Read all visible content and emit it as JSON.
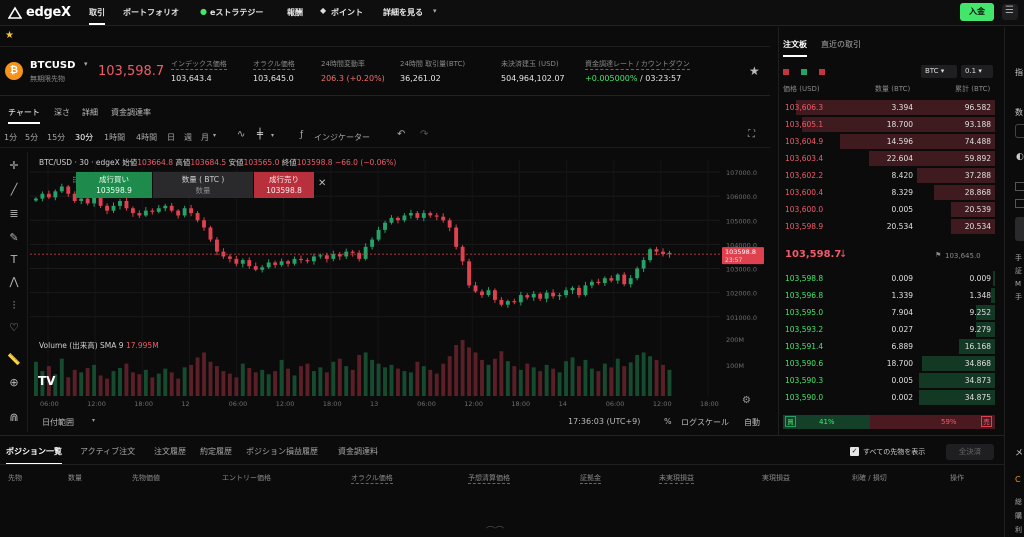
{
  "nav": {
    "brand": "edgeX",
    "items": [
      "取引",
      "ポートフォリオ",
      "eストラテジー",
      "報酬",
      "ポイント",
      "詳細を見る"
    ],
    "deposit_label": "入金"
  },
  "ticker": {
    "symbol": "BTCUSD",
    "subtitle": "無期限先物",
    "price": "103,598.7",
    "stats": [
      {
        "label": "インデックス価格",
        "value": "103,643.4",
        "color": "#e6e6e6"
      },
      {
        "label": "オラクル価格",
        "value": "103,645.0",
        "color": "#e6e6e6"
      },
      {
        "label": "24時間変動率",
        "value": "206.3 (+0.20%)",
        "color": "#f26d6d"
      },
      {
        "label": "24時間 取引量(BTC)",
        "value": "36,261.02",
        "color": "#e6e6e6"
      },
      {
        "label": "未決済建玉 (USD)",
        "value": "504,964,102.07",
        "color": "#e6e6e6"
      },
      {
        "label": "資金調達レート / カウントダウン",
        "value_green": "+0.005000%",
        "value_rest": " / 03:23:57"
      }
    ]
  },
  "chart_tabs": [
    "チャート",
    "深さ",
    "詳細",
    "資金調達率"
  ],
  "toolbar": {
    "intervals": [
      "1分",
      "5分",
      "15分",
      "30分",
      "1時間",
      "4時間",
      "日",
      "週",
      "月"
    ],
    "indicator_label": "インジケーター"
  },
  "chart_legend": {
    "pair": "BTC/USD · 30 · edgeX",
    "open_label": "始値",
    "open": "103664.8",
    "high_label": "高値",
    "high": "103684.5",
    "low_label": "安値",
    "low": "103565.0",
    "close_label": "終値",
    "close": "103598.8",
    "change": "−66.0 (−0.06%)",
    "volume_label": "Volume (出来高)",
    "sma_label": "SMA 9",
    "sma_value": "17.995M"
  },
  "quick_trade": {
    "buy_label": "成行買い",
    "buy_price": "103598.9",
    "qty_label": "数量 ( BTC )",
    "qty_placeholder": "数量",
    "sell_label": "成行売り",
    "sell_price": "103598.8"
  },
  "chart_footer": {
    "range_label": "日付範囲",
    "time": "17:36:03 (UTC+9)",
    "percent": "%",
    "log_label": "ログスケール",
    "auto_label": "自動"
  },
  "chart_data": {
    "type": "candlestick",
    "price_axis_ticks": [
      "107000.0",
      "106000.0",
      "105000.0",
      "104000.0",
      "103000.0",
      "102000.0",
      "101000.0"
    ],
    "volume_axis_ticks": [
      "200M",
      "100M"
    ],
    "x_ticks": [
      "06:00",
      "12:00",
      "18:00",
      "12",
      "06:00",
      "12:00",
      "18:00",
      "13",
      "06:00",
      "12:00",
      "18:00",
      "14",
      "06:00",
      "12:00",
      "18:00"
    ],
    "last_price_tag": "103598.8",
    "last_price_countdown": "23:57",
    "closes": [
      105900,
      106100,
      105950,
      106200,
      106400,
      106100,
      105800,
      105900,
      105700,
      106000,
      105600,
      105400,
      105600,
      105800,
      105500,
      105300,
      105200,
      105400,
      105350,
      105500,
      105600,
      105400,
      105200,
      105500,
      105300,
      105000,
      104700,
      104200,
      103700,
      103500,
      103400,
      103200,
      103350,
      103100,
      102950,
      103050,
      103250,
      103150,
      103300,
      103200,
      103400,
      103350,
      103300,
      103500,
      103550,
      103400,
      103600,
      103500,
      103700,
      103650,
      103400,
      103900,
      104200,
      104600,
      104900,
      105100,
      105000,
      105200,
      105300,
      105100,
      105300,
      105200,
      105150,
      105000,
      104700,
      103900,
      103300,
      102300,
      102050,
      101900,
      102100,
      101700,
      101500,
      101650,
      101600,
      101900,
      101800,
      101950,
      101750,
      102000,
      101850,
      101900,
      102100,
      102200,
      101900,
      102300,
      102450,
      102400,
      102600,
      102500,
      102750,
      102350,
      102600,
      103000,
      103350,
      103800,
      103700,
      103600,
      103650
    ],
    "volumes": [
      55,
      40,
      48,
      35,
      60,
      30,
      42,
      38,
      45,
      50,
      33,
      28,
      40,
      45,
      52,
      38,
      35,
      42,
      30,
      36,
      44,
      38,
      28,
      46,
      50,
      62,
      70,
      55,
      48,
      40,
      36,
      30,
      52,
      45,
      38,
      42,
      35,
      40,
      58,
      44,
      33,
      48,
      52,
      40,
      46,
      38,
      55,
      60,
      48,
      42,
      66,
      70,
      58,
      52,
      46,
      50,
      44,
      40,
      38,
      55,
      48,
      42,
      36,
      52,
      64,
      82,
      90,
      78,
      70,
      58,
      50,
      60,
      72,
      56,
      48,
      42,
      52,
      46,
      40,
      50,
      44,
      38,
      56,
      62,
      48,
      58,
      44,
      40,
      52,
      46,
      60,
      48,
      54,
      66,
      70,
      64,
      58,
      50,
      42
    ]
  },
  "orderbook": {
    "tabs": [
      "注文板",
      "直近の取引"
    ],
    "asset_select": "BTC",
    "step_select": "0.1",
    "headers": {
      "price": "価格 (USD)",
      "size": "数量 (BTC)",
      "total": "累計 (BTC)"
    },
    "asks": [
      {
        "price": "103,606.3",
        "size": "3.394",
        "total": "96.582",
        "depth": 0.95
      },
      {
        "price": "103,605.1",
        "size": "18.700",
        "total": "93.188",
        "depth": 0.92
      },
      {
        "price": "103,604.9",
        "size": "14.596",
        "total": "74.488",
        "depth": 0.74
      },
      {
        "price": "103,603.4",
        "size": "22.604",
        "total": "59.892",
        "depth": 0.6
      },
      {
        "price": "103,602.2",
        "size": "8.420",
        "total": "37.288",
        "depth": 0.37
      },
      {
        "price": "103,600.4",
        "size": "8.329",
        "total": "28.868",
        "depth": 0.29
      },
      {
        "price": "103,600.0",
        "size": "0.005",
        "total": "20.539",
        "depth": 0.21
      },
      {
        "price": "103,598.9",
        "size": "20.534",
        "total": "20.534",
        "depth": 0.21
      }
    ],
    "mid_price": "103,598.7",
    "mid_mark": "103,645.0",
    "bids": [
      {
        "price": "103,598.8",
        "size": "0.009",
        "total": "0.009",
        "depth": 0.01
      },
      {
        "price": "103,596.8",
        "size": "1.339",
        "total": "1.348",
        "depth": 0.02
      },
      {
        "price": "103,595.0",
        "size": "7.904",
        "total": "9.252",
        "depth": 0.09
      },
      {
        "price": "103,593.2",
        "size": "0.027",
        "total": "9.279",
        "depth": 0.09
      },
      {
        "price": "103,591.4",
        "size": "6.889",
        "total": "16.168",
        "depth": 0.17
      },
      {
        "price": "103,590.6",
        "size": "18.700",
        "total": "34.868",
        "depth": 0.35
      },
      {
        "price": "103,590.3",
        "size": "0.005",
        "total": "34.873",
        "depth": 0.36
      },
      {
        "price": "103,590.0",
        "size": "0.002",
        "total": "34.875",
        "depth": 0.36
      }
    ],
    "buy_tag": "買",
    "buy_pct": "41%",
    "sell_pct": "59%",
    "sell_tag": "売",
    "buy_ratio": 0.41
  },
  "bottom": {
    "tabs": [
      "ポジション一覧",
      "アクティブ注文",
      "注文履歴",
      "約定履歴",
      "ポジション損益履歴",
      "資金調達料"
    ],
    "show_all_label": "すべての先物を表示",
    "close_all_label": "全決済",
    "columns": [
      "先物",
      "数量",
      "先物価値",
      "エントリー価格",
      "オラクル価格",
      "予想清算価格",
      "証拠金",
      "未実現損益",
      "実現損益",
      "利確 / 損切",
      "操作"
    ]
  },
  "colors": {
    "up": "#26a269",
    "down": "#e0414f",
    "accent": "#43e66b"
  }
}
